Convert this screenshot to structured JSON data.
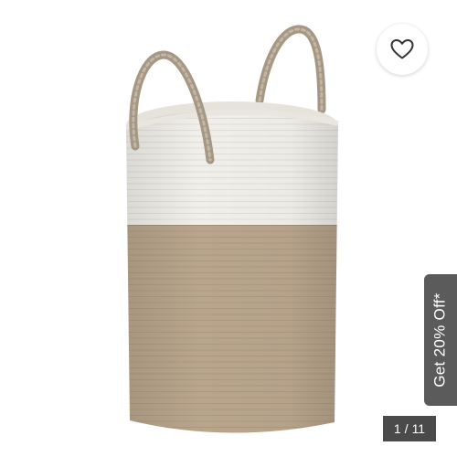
{
  "product": {
    "image_alt": "Cotton rope laundry basket with handles, white top and tan bottom"
  },
  "favorite": {
    "icon": "heart-outline-icon",
    "color": "#333333"
  },
  "promo": {
    "label": "Get 20% Off*",
    "background": "#5b5b5b"
  },
  "gallery": {
    "current": "1",
    "separator": "/",
    "total": "11"
  },
  "colors": {
    "basket_top": "#f1efea",
    "basket_bottom": "#b9a58c",
    "handle": "#a69784"
  }
}
